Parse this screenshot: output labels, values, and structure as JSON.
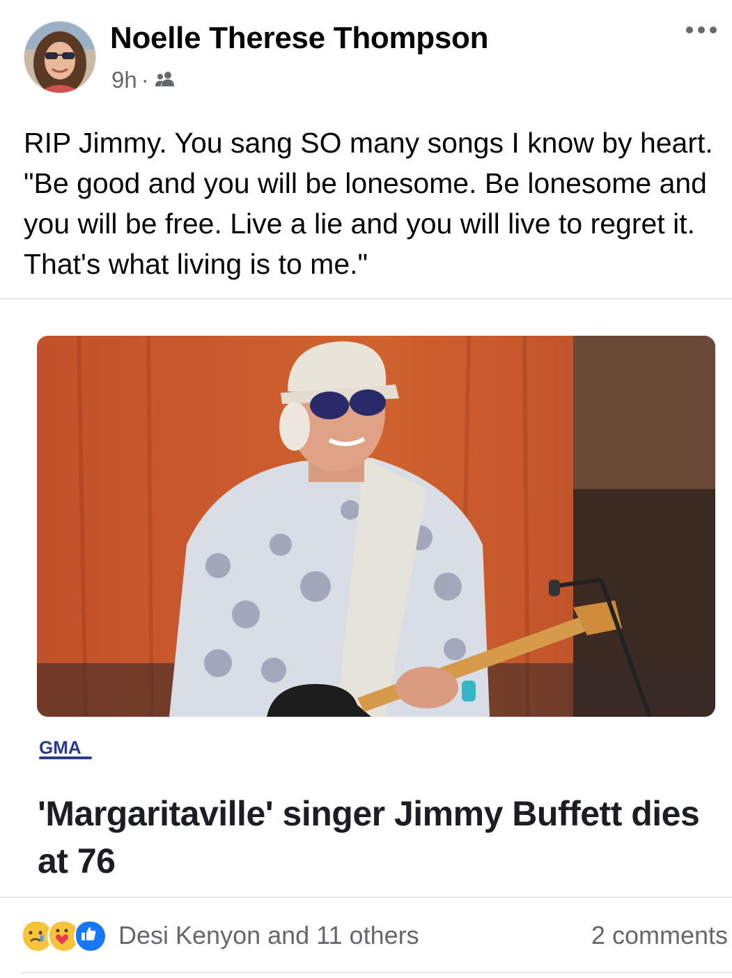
{
  "post": {
    "author": "Noelle Therese Thompson",
    "time": "9h",
    "separator": "·",
    "audience_icon": "friends-icon",
    "more_icon": "more-options-icon",
    "text": "RIP Jimmy. You sang SO many songs I know by heart. \"Be good and you will be lonesome. Be lonesome and you will be free. Live a lie and you will live to regret it. That's what living is to me.\""
  },
  "link": {
    "source": "GMA",
    "headline": "'Margaritaville' singer Jimmy Buffett dies at 76",
    "image": "photo of smiling man in white cap and sunglasses playing guitar on stage"
  },
  "footer": {
    "reaction_icons": [
      "sad-reaction-icon",
      "care-reaction-icon",
      "like-reaction-icon"
    ],
    "reaction_summary": "Desi Kenyon and 11 others",
    "comments": "2 comments"
  },
  "colors": {
    "secondary_text": "#65676b",
    "like_blue": "#1877f2",
    "gma_blue": "#2b3a8a",
    "divider": "#e4e6eb"
  }
}
